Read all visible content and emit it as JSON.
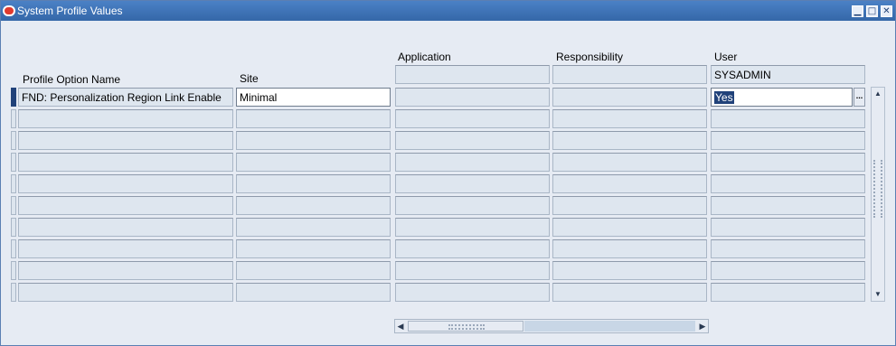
{
  "window": {
    "title": "System Profile Values",
    "buttons": [
      "minimize",
      "maximize",
      "close"
    ]
  },
  "columns": {
    "profile_option_name": "Profile Option Name",
    "site": "Site",
    "application": "Application",
    "responsibility": "Responsibility",
    "user": "User"
  },
  "header_values": {
    "user": "SYSADMIN"
  },
  "rows": [
    {
      "name": "FND: Personalization Region Link Enable",
      "site": "Minimal",
      "application": "",
      "responsibility": "",
      "user": "Yes"
    },
    {
      "name": "",
      "site": "",
      "application": "",
      "responsibility": "",
      "user": ""
    },
    {
      "name": "",
      "site": "",
      "application": "",
      "responsibility": "",
      "user": ""
    },
    {
      "name": "",
      "site": "",
      "application": "",
      "responsibility": "",
      "user": ""
    },
    {
      "name": "",
      "site": "",
      "application": "",
      "responsibility": "",
      "user": ""
    },
    {
      "name": "",
      "site": "",
      "application": "",
      "responsibility": "",
      "user": ""
    },
    {
      "name": "",
      "site": "",
      "application": "",
      "responsibility": "",
      "user": ""
    },
    {
      "name": "",
      "site": "",
      "application": "",
      "responsibility": "",
      "user": ""
    },
    {
      "name": "",
      "site": "",
      "application": "",
      "responsibility": "",
      "user": ""
    },
    {
      "name": "",
      "site": "",
      "application": "",
      "responsibility": "",
      "user": ""
    }
  ],
  "lov_button_label": "...",
  "colors": {
    "titlebar": "#3567a8",
    "background": "#e6ebf3",
    "selection": "#21427a"
  }
}
